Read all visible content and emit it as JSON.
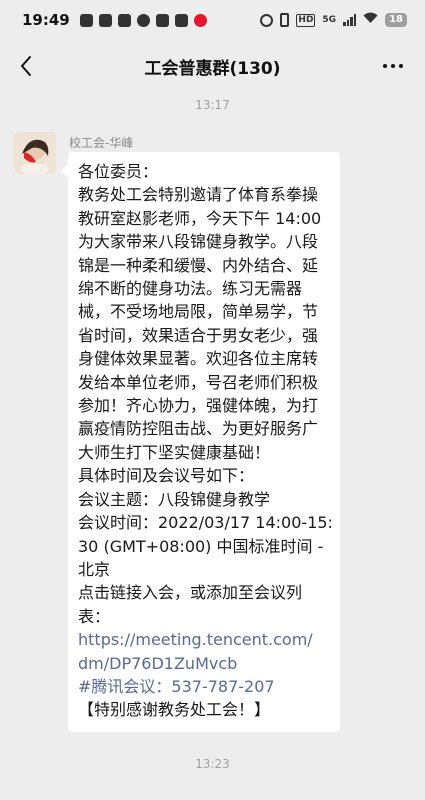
{
  "status_bar": {
    "time": "19:49",
    "network": "5G",
    "hd": "HD",
    "battery": "18"
  },
  "nav": {
    "title": "工会普惠群(130)"
  },
  "timestamps": [
    "13:17",
    "13:23"
  ],
  "message": {
    "sender": "校工会-华峰",
    "lines": [
      "各位委员：",
      "教务处工会特别邀请了体育系拳操",
      "教研室赵影老师，今天下午 14:00",
      "为大家带来八段锦健身教学。八段",
      "锦是一种柔和缓慢、内外结合、延",
      "绵不断的健身功法。练习无需器",
      "械，不受场地局限，简单易学，节",
      "省时间，效果适合于男女老少，强",
      "身健体效果显著。欢迎各位主席转",
      "发给本单位老师，号召老师们积极",
      "参加！齐心协力，强健体魄，为打",
      "赢疫情防控阻击战、为更好服务广",
      "大师生打下坚实健康基础！",
      "具体时间及会议号如下：",
      "会议主题：八段锦健身教学",
      "会议时间：2022/03/17 14:00-15:",
      "30 (GMT+08:00) 中国标准时间 -",
      "北京",
      "点击链接入会，或添加至会议列",
      "表：",
      "https://meeting.tencent.com/",
      "dm/DP76D1ZuMvcb",
      "#腾讯会议：537-787-207",
      "【特别感谢教务处工会！】"
    ],
    "link_line_indices": [
      20,
      21,
      22
    ]
  },
  "colors": {
    "background": "#ededed",
    "bubble": "#ffffff",
    "link": "#576b95",
    "timestamp": "#a0a0a0"
  }
}
